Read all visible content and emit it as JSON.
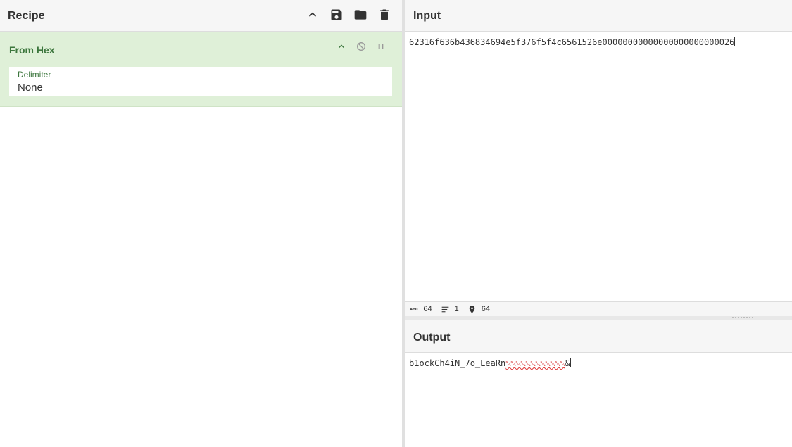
{
  "recipe": {
    "title": "Recipe",
    "icons": [
      "chevron-up-icon",
      "save-icon",
      "folder-icon",
      "trash-icon"
    ],
    "operation": {
      "name": "From Hex",
      "arg_label": "Delimiter",
      "arg_value": "None"
    }
  },
  "input": {
    "title": "Input",
    "value": "62316f636b436834694e5f376f5f4c6561526e00000000000000000000000026"
  },
  "status": {
    "length": "64",
    "lines": "1",
    "position": "64"
  },
  "output": {
    "title": "Output",
    "text": "b1ockCh4iN_7o_LeaRn",
    "control_chars": "␀␀␀␀␀␀␀␀␀␀␀␀",
    "tail": "&"
  },
  "colors": {
    "operation_bg": "#dff0d8",
    "operation_text": "#3c763d",
    "header_bg": "#f6f6f6"
  }
}
